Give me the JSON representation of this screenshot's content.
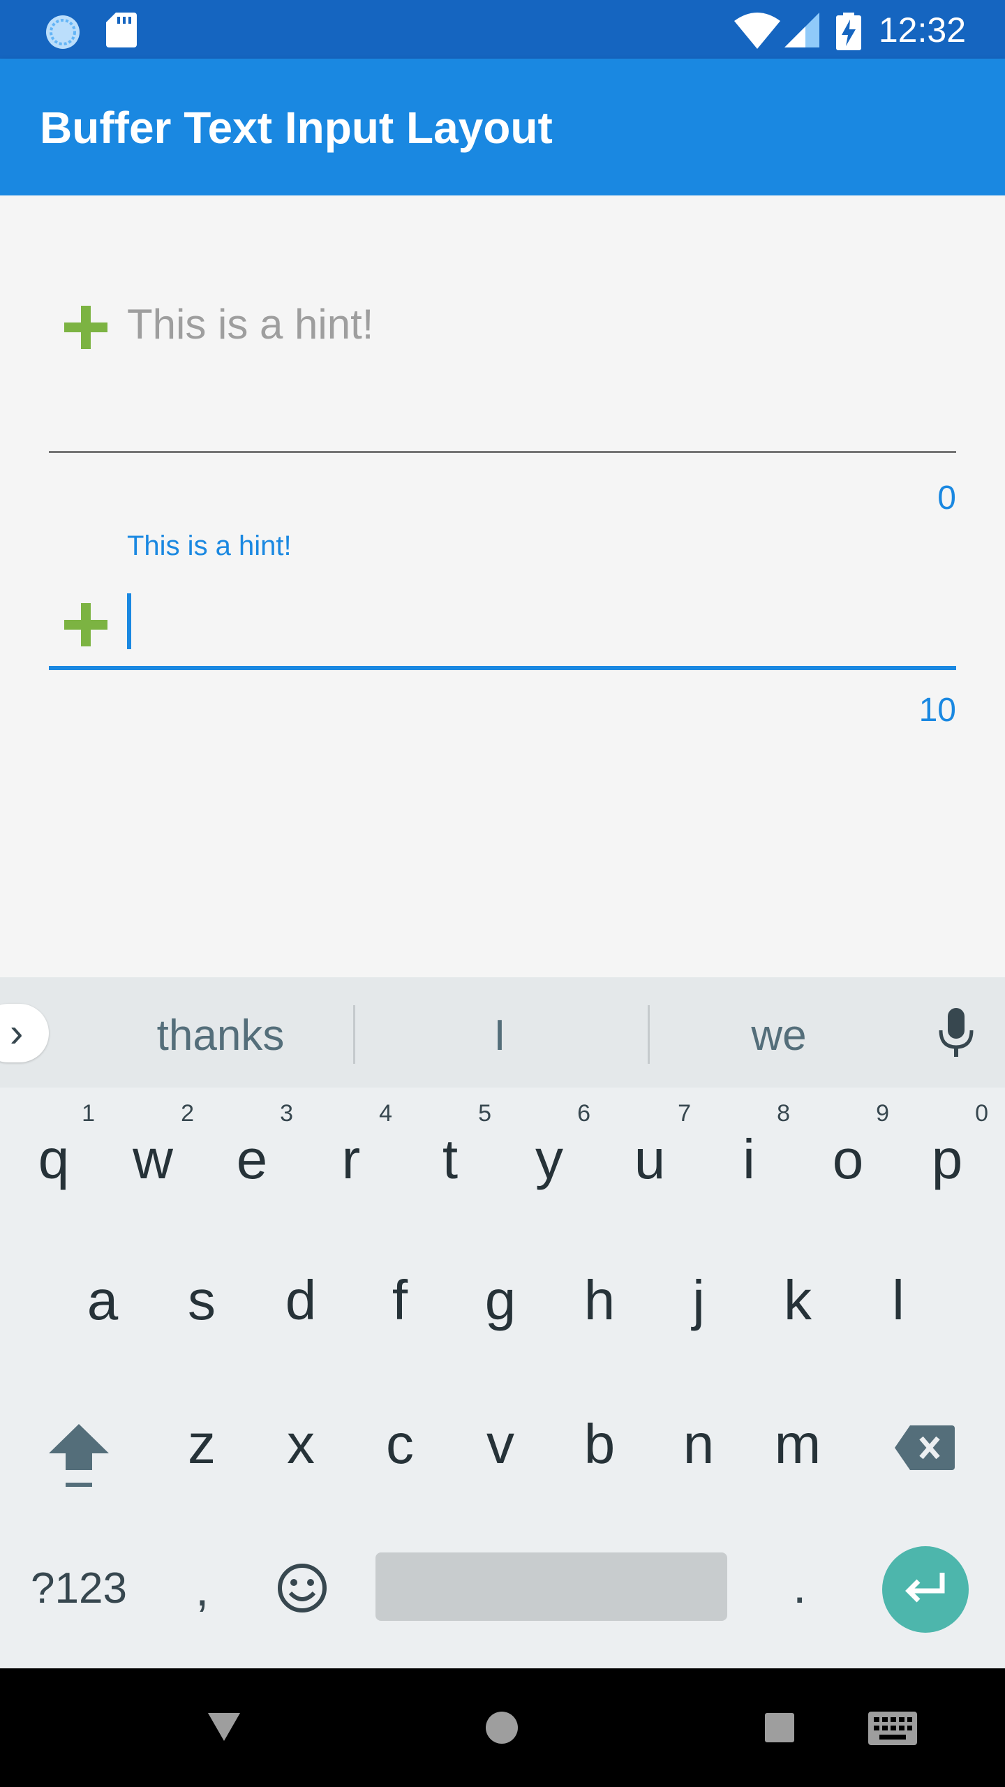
{
  "status_bar": {
    "time": "12:32",
    "icons": [
      "sync-icon",
      "sd-card-icon",
      "wifi-icon",
      "signal-icon",
      "battery-charging-icon"
    ]
  },
  "app_bar": {
    "title": "Buffer Text Input Layout"
  },
  "fields": [
    {
      "hint": "This is a hint!",
      "counter": "0",
      "state": "unfocused"
    },
    {
      "floating_label": "This is a hint!",
      "counter": "10",
      "state": "focused"
    }
  ],
  "keyboard": {
    "suggestions": [
      "thanks",
      "I",
      "we"
    ],
    "row1": [
      {
        "key": "q",
        "num": "1"
      },
      {
        "key": "w",
        "num": "2"
      },
      {
        "key": "e",
        "num": "3"
      },
      {
        "key": "r",
        "num": "4"
      },
      {
        "key": "t",
        "num": "5"
      },
      {
        "key": "y",
        "num": "6"
      },
      {
        "key": "u",
        "num": "7"
      },
      {
        "key": "i",
        "num": "8"
      },
      {
        "key": "o",
        "num": "9"
      },
      {
        "key": "p",
        "num": "0"
      }
    ],
    "row2": [
      "a",
      "s",
      "d",
      "f",
      "g",
      "h",
      "j",
      "k",
      "l"
    ],
    "row3": [
      "z",
      "x",
      "c",
      "v",
      "b",
      "n",
      "m"
    ],
    "symbols_label": "?123",
    "comma": ",",
    "period": "."
  },
  "colors": {
    "primary": "#1a88e1",
    "status_bar": "#1565c0",
    "accent_enter": "#4db6ac",
    "plus_icon": "#7cb342"
  }
}
